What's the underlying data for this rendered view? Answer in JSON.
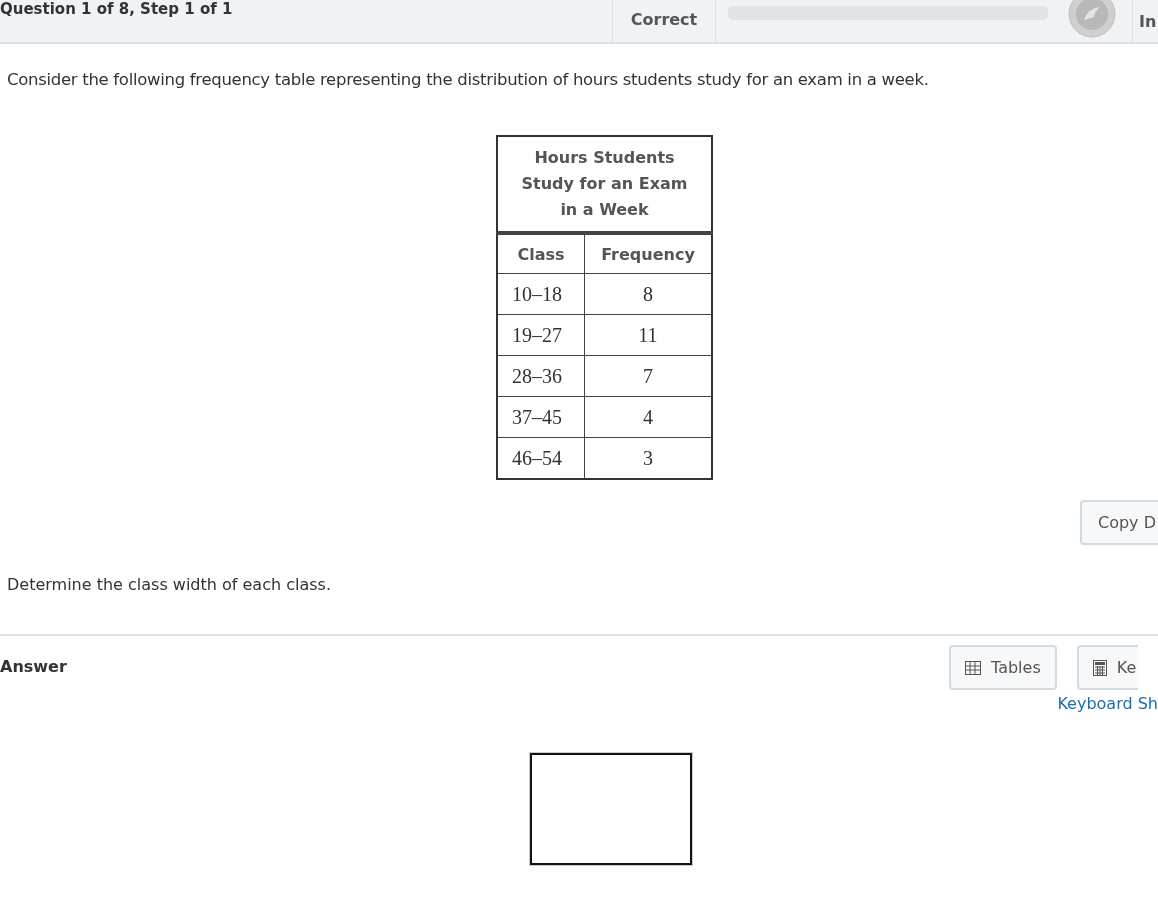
{
  "header": {
    "question_label": "Question 1 of 8,  Step 1 of 1",
    "score_label": "Correct",
    "progress": {
      "level": 0
    },
    "right_label": "In"
  },
  "question": {
    "prompt": "Consider the following frequency table representing the distribution of hours students study for an exam in a week.",
    "table": {
      "title": "Hours Students Study for an Exam in a Week",
      "columns": [
        "Class",
        "Frequency"
      ],
      "rows": [
        [
          "10–18",
          "8"
        ],
        [
          "19–27",
          "11"
        ],
        [
          "28–36",
          "7"
        ],
        [
          "37–45",
          "4"
        ],
        [
          "46–54",
          "3"
        ]
      ]
    },
    "copy_button": "Copy D",
    "instruction": "Determine the class width of each class."
  },
  "answer": {
    "label": "Answer",
    "tables_button": "Tables",
    "keypad_button": "Ke",
    "shortcuts_link": "Keyboard Sh"
  }
}
